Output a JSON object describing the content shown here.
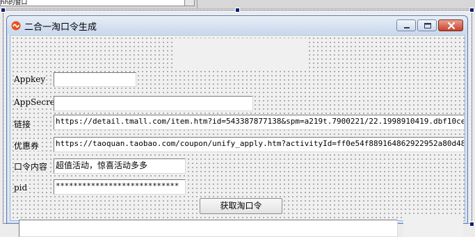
{
  "designer": {
    "top_field_text": "hh的窗口"
  },
  "window": {
    "title": "二合一淘口令生成"
  },
  "form": {
    "appkey": {
      "label": "Appkey",
      "value": ""
    },
    "appsecret": {
      "label": "AppSecret",
      "value": ""
    },
    "link": {
      "label": "链接",
      "value": "https://detail.tmall.com/item.htm?id=543387877138&spm=a219t.7900221/22.1998910419.dbf10ce6amuying."
    },
    "coupon": {
      "label": "优惠券",
      "value": "https://taoquan.taobao.com/coupon/unify_apply.htm?activityId=ff0e54f889164862922952a80d48e846&sell"
    },
    "content": {
      "label": "口令内容",
      "value": "超值活动，惊喜活动多多"
    },
    "pid": {
      "label": "pid",
      "value": "****************************"
    },
    "submit_label": "获取淘口令",
    "output_value": ""
  },
  "colors": {
    "accent": "#0b1f73",
    "close_button": "#c9412b",
    "title_gradient_top": "#e7eef8"
  },
  "icons": {
    "app": "app-logo-icon",
    "minimize": "minimize-icon",
    "maximize": "maximize-icon",
    "close": "close-icon"
  }
}
